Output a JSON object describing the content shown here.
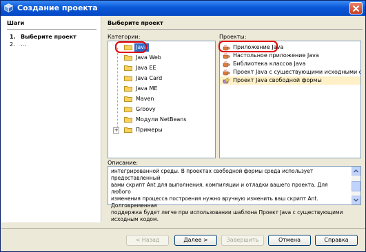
{
  "window": {
    "title": "Создание проекта"
  },
  "steps": {
    "heading": "Шаги",
    "items": [
      {
        "num": "1.",
        "label": "Выберите проект"
      },
      {
        "num": "2.",
        "label": "..."
      }
    ]
  },
  "main": {
    "heading": "Выберите проект",
    "categories_label": "Категории:",
    "projects_label": "Проекты:",
    "description_label": "Описание:"
  },
  "categories": [
    {
      "label": "Java",
      "selected": true,
      "icon": "folder-icon"
    },
    {
      "label": "Java Web",
      "icon": "folder-icon"
    },
    {
      "label": "Java EE",
      "icon": "folder-icon"
    },
    {
      "label": "Java Card",
      "icon": "folder-icon"
    },
    {
      "label": "Java ME",
      "icon": "folder-icon"
    },
    {
      "label": "Maven",
      "icon": "folder-icon"
    },
    {
      "label": "Groovy",
      "icon": "folder-icon"
    },
    {
      "label": "Модули NetBeans",
      "icon": "folder-icon"
    },
    {
      "label": "Примеры",
      "icon": "folder-icon",
      "expander": "+"
    }
  ],
  "projects": [
    {
      "label": "Приложение Java",
      "icon": "java-cup-icon"
    },
    {
      "label": "Настольное приложение Java",
      "icon": "java-cup-icon"
    },
    {
      "label": "Библиотека классов Java",
      "icon": "java-cup-icon"
    },
    {
      "label": "Проект Java с существующими исходными файлами",
      "icon": "java-cup-icon"
    },
    {
      "label": "Проект Java свободной формы",
      "icon": "freeform-icon",
      "selected": true
    }
  ],
  "description": {
    "lines": [
      "интегрированной среды. В проектах свободной формы среда использует предоставленный",
      "вами скрипт Ant для выполнения, компиляции и отладки вашего проекта. Для любого",
      "изменения процесса построения нужно вручную изменить ваш скрипт Ant. Долговременная",
      "поддержка будет легче при использовании шаблона Проект Java с существующими",
      "исходным кодом."
    ]
  },
  "buttons": {
    "back": "< Назад",
    "next": "Далее >",
    "finish": "Завершить",
    "cancel": "Отмена",
    "help": "Справка"
  },
  "colors": {
    "titlebar": "#0a58d8",
    "selection": "#316ac5",
    "selected_row": "#fff0c8",
    "highlight_marker": "#e00000"
  }
}
